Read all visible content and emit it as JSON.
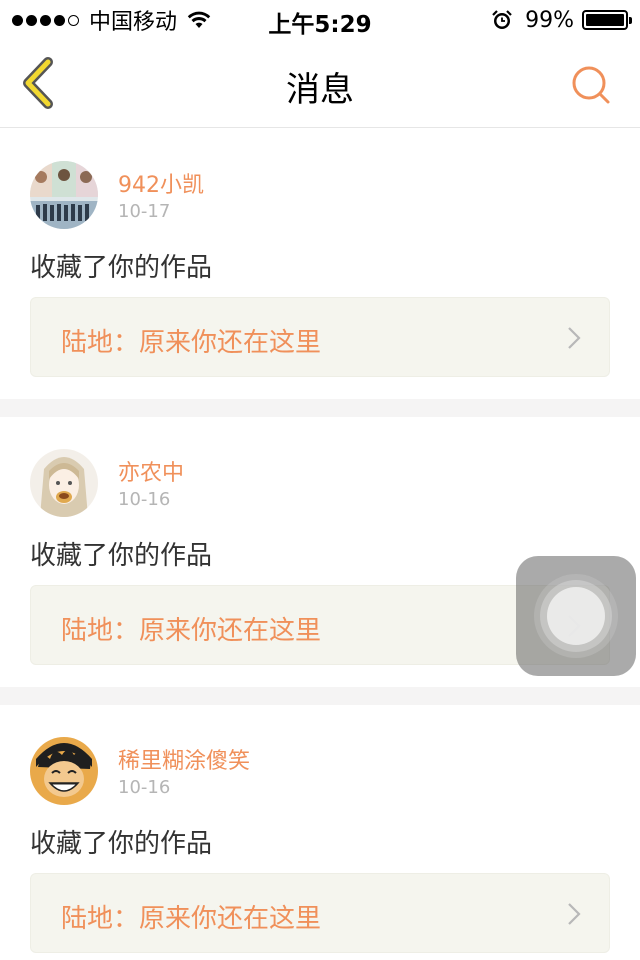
{
  "status_bar": {
    "carrier": "中国移动",
    "time": "上午5:29",
    "battery_percent": "99%",
    "battery_level": 0.99,
    "signal_bars_filled": 4,
    "signal_bars_total": 5,
    "icons": [
      "signal-dots-icon",
      "wifi-icon",
      "alarm-icon",
      "battery-icon"
    ]
  },
  "nav": {
    "title": "消息",
    "back_icon": "chevron-left-icon",
    "search_icon": "search-icon",
    "accent_color": "#f0905a",
    "back_color": "#f2d830"
  },
  "messages": [
    {
      "username": "942小凯",
      "date": "10-17",
      "action": "收藏了你的作品",
      "work_title": "陆地：原来你还在这里"
    },
    {
      "username": "亦农中",
      "date": "10-16",
      "action": "收藏了你的作品",
      "work_title": "陆地：原来你还在这里"
    },
    {
      "username": "稀里糊涂傻笑",
      "date": "10-16",
      "action": "收藏了你的作品",
      "work_title": "陆地：原来你还在这里"
    }
  ],
  "colors": {
    "username": "#f0905a",
    "date": "#b5b5b5",
    "work_bg": "#f5f5ee",
    "separator": "#f5f4f4"
  }
}
